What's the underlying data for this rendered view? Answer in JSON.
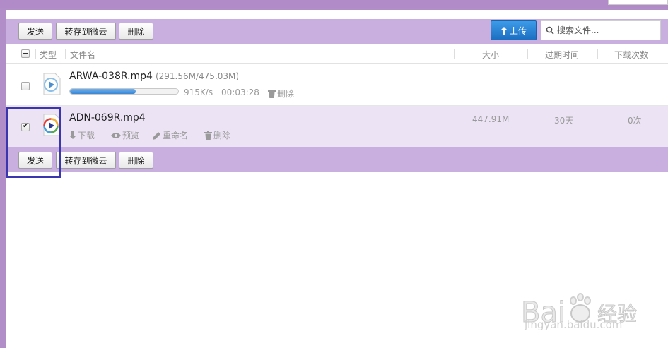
{
  "toolbar": {
    "send_label": "发送",
    "save_to_weiyun_label": "转存到微云",
    "delete_label": "删除",
    "upload_label": "上传",
    "search_placeholder": "搜索文件..."
  },
  "columns": {
    "type": "类型",
    "filename": "文件名",
    "size": "大小",
    "expire": "过期时间",
    "download_count": "下载次数"
  },
  "files": [
    {
      "name": "ARWA-038R.mp4",
      "size_progress": "(291.56M/475.03M)",
      "progress": 0.61,
      "speed": "915K/s",
      "remaining": "00:03:28",
      "delete_label": "删除",
      "selected": false
    },
    {
      "name": "ADN-069R.mp4",
      "size": "447.91M",
      "expire": "30天",
      "download_count": "0次",
      "download_label": "下载",
      "preview_label": "预览",
      "rename_label": "重命名",
      "delete_label": "删除",
      "selected": true
    }
  ],
  "watermark": {
    "logo_text": "Bai du 经验",
    "url": "jingyan.baidu.com"
  },
  "colors": {
    "toolbar_bg": "#c9afdf",
    "selected_row_bg": "#ece3f4",
    "upload_button": "#2a80d2",
    "highlight_box": "#3c35b0"
  }
}
